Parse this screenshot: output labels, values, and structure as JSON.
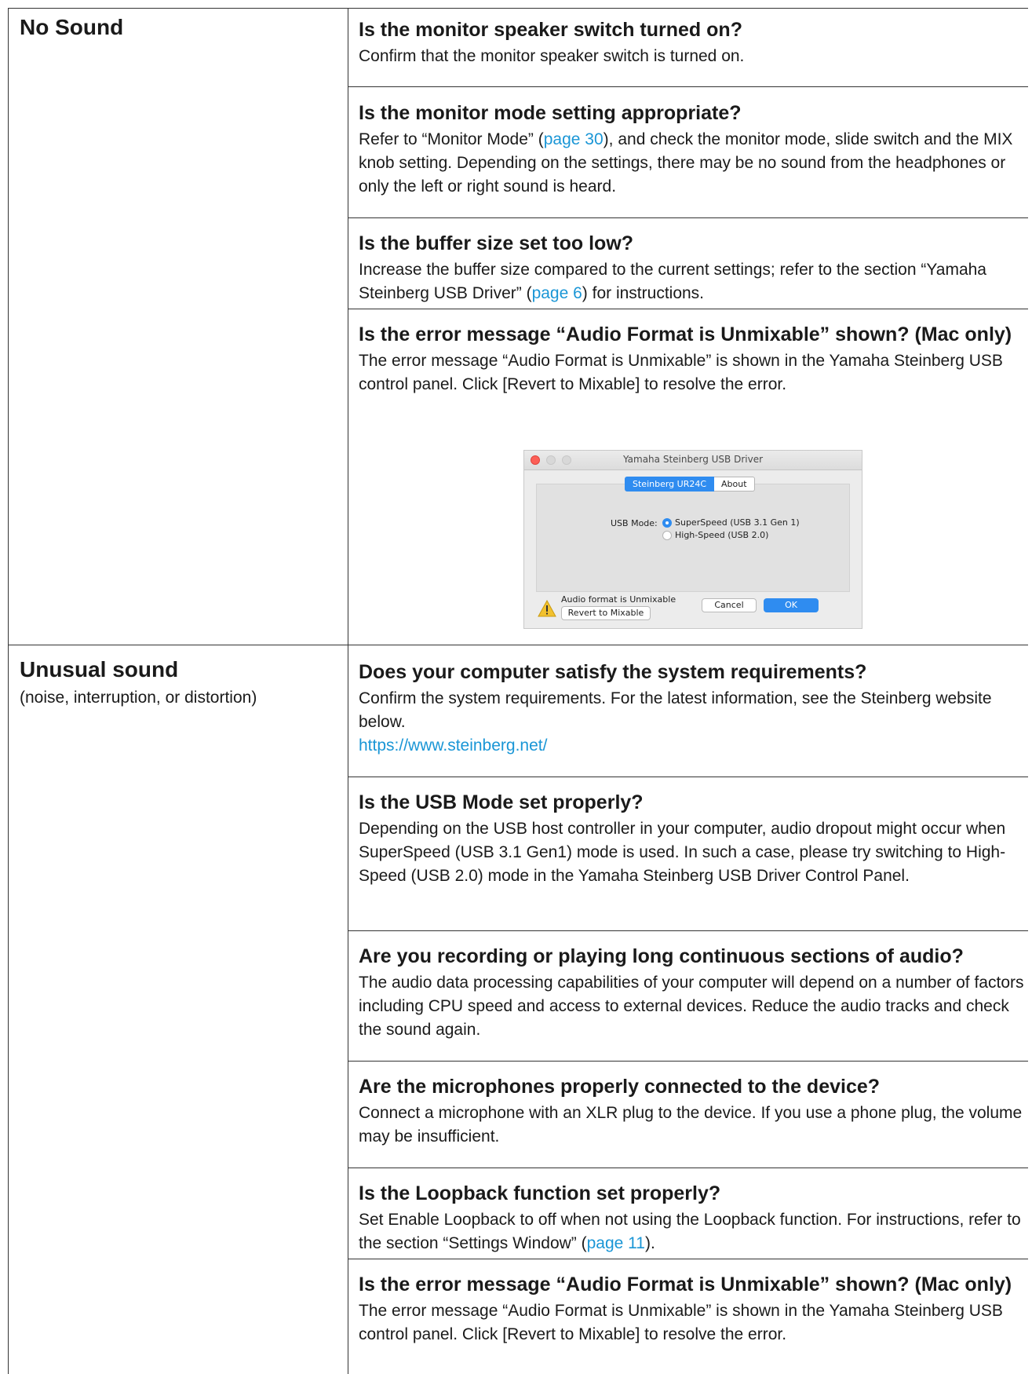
{
  "no_sound": {
    "title": "No Sound",
    "items": [
      {
        "q": "Is the monitor speaker switch turned on?",
        "a": "Confirm that the monitor speaker switch is turned on."
      },
      {
        "q": "Is the monitor mode setting appropriate?",
        "a1": "Refer to “Monitor Mode” (",
        "link": "page 30",
        "a2": "), and check the monitor mode, slide switch and the MIX knob setting. Depending on the settings, there may be no sound from the headphones or only the left or right sound is heard."
      },
      {
        "q": "Is the buffer size set too low?",
        "a1": "Increase the buffer size compared to the current settings; refer to the section “Yamaha Steinberg USB Driver” (",
        "link": "page 6",
        "a2": ") for instructions."
      },
      {
        "q": "Is the error message “Audio Format is Unmixable” shown? (Mac only)",
        "a": "The error message “Audio Format is Unmixable” is shown in the Yamaha Steinberg USB control panel. Click [Revert to Mixable] to resolve the error."
      }
    ]
  },
  "dialog": {
    "title": "Yamaha Steinberg USB Driver",
    "tab_active": "Steinberg UR24C",
    "tab_other": "About",
    "usb_mode_label": "USB Mode:",
    "option_1": "SuperSpeed (USB 3.1 Gen 1)",
    "option_2": "High-Speed (USB 2.0)",
    "selected": "SuperSpeed (USB 3.1 Gen 1)",
    "warning": "Audio format is Unmixable",
    "revert_button": "Revert to Mixable",
    "cancel_button": "Cancel",
    "ok_button": "OK",
    "accent_color": "#2f8cf0",
    "warning_icon": "warning-triangle-icon"
  },
  "unusual": {
    "title": "Unusual sound",
    "subtitle": "(noise, interruption, or distortion)",
    "items": [
      {
        "q": "Does your computer satisfy the system requirements?",
        "a": "Confirm the system requirements. For the latest information, see the Steinberg website below.",
        "link": "https://www.steinberg.net/"
      },
      {
        "q": "Is the USB Mode set properly?",
        "a": "Depending on the USB host controller in your computer, audio dropout might occur when SuperSpeed (USB 3.1 Gen1) mode is used. In such a case, please try switching to High-Speed (USB 2.0) mode in the Yamaha Steinberg USB Driver Control Panel."
      },
      {
        "q": "Are you recording or playing long continuous sections of audio?",
        "a": "The audio data processing capabilities of your computer will depend on a number of factors including CPU speed and access to external devices. Reduce the audio tracks and check the sound again."
      },
      {
        "q": "Are the microphones properly connected to the device?",
        "a": "Connect a microphone with an XLR plug to the device. If you use a phone plug, the volume may be insufficient."
      },
      {
        "q": "Is the Loopback function set properly?",
        "a1": "Set Enable Loopback to off when not using the Loopback function. For instructions, refer to the section “Settings Window” (",
        "link": "page 11",
        "a2": ")."
      },
      {
        "q": "Is the error message “Audio Format is Unmixable” shown? (Mac only)",
        "a": "The error message “Audio Format is Unmixable” is shown in the Yamaha Steinberg USB control panel. Click [Revert to Mixable] to resolve the error."
      }
    ]
  },
  "link_color": "#1a96d6"
}
